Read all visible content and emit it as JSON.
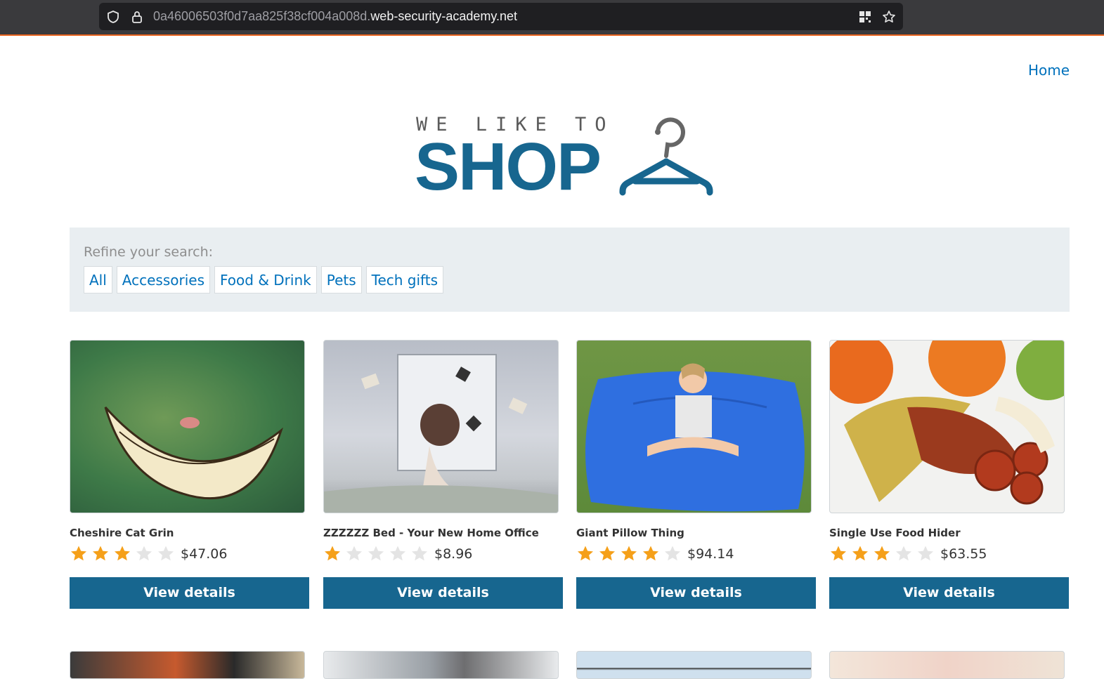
{
  "browser": {
    "url_prefix": "0a46006503f0d7aa825f38cf004a008d.",
    "url_domain": "web-security-academy.net"
  },
  "nav": {
    "home_label": "Home"
  },
  "logo": {
    "tagline": "WE LIKE TO",
    "wordmark": "SHOP"
  },
  "filters": {
    "label": "Refine your search:",
    "categories": [
      "All",
      "Accessories",
      "Food & Drink",
      "Pets",
      "Tech gifts"
    ]
  },
  "products": [
    {
      "name": "Cheshire Cat Grin",
      "rating": 3,
      "price": "$47.06",
      "button": "View details"
    },
    {
      "name": "ZZZZZZ Bed - Your New Home Office",
      "rating": 1,
      "price": "$8.96",
      "button": "View details"
    },
    {
      "name": "Giant Pillow Thing",
      "rating": 4,
      "price": "$94.14",
      "button": "View details"
    },
    {
      "name": "Single Use Food Hider",
      "rating": 3,
      "price": "$63.55",
      "button": "View details"
    }
  ],
  "colors": {
    "accent": "#17668f",
    "link": "#0071bc",
    "star_on": "#f5a01a",
    "star_off": "#e4e4e4"
  }
}
